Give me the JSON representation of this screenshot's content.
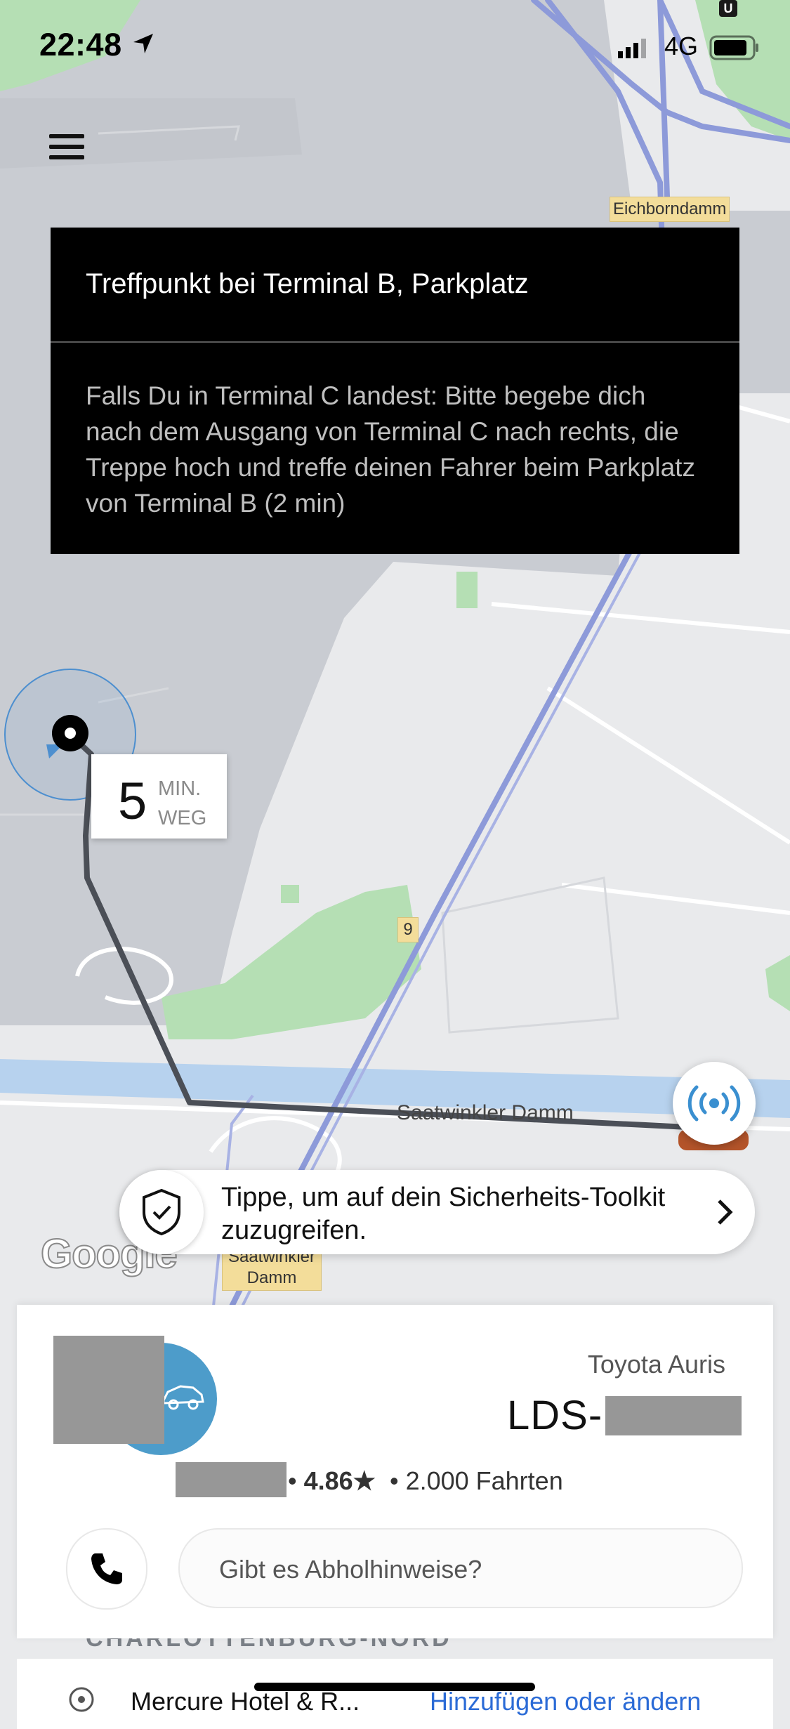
{
  "status_bar": {
    "time": "22:48",
    "network": "4G"
  },
  "map": {
    "labels": {
      "eichborndamm": "Eichborndamm",
      "route_9": "9",
      "saatwinkler_street": "Saatwinkler Damm",
      "saatwinkler_badge": "Saatwinkler\nDamm",
      "district": "CHARLOTTENBURG-NORD"
    },
    "google_logo": "Google"
  },
  "info_panel": {
    "title": "Treffpunkt bei Terminal B, Parkplatz",
    "body": "Falls Du in Terminal C landest: Bitte begebe dich nach dem Ausgang von Terminal C nach rechts, die Treppe hoch und treffe deinen Fahrer beim Parkplatz von Terminal B (2 min)"
  },
  "eta": {
    "value": "5",
    "unit_line1": "MIN.",
    "unit_line2": "WEG"
  },
  "safety": {
    "text": "Tippe, um auf dein Sicherheits-Toolkit zuzugreifen."
  },
  "driver_card": {
    "car_model": "Toyota Auris",
    "plate_prefix": "LDS-",
    "rating": "4.86★",
    "trips": "2.000 Fahrten",
    "notes_placeholder": "Gibt es Abholhinweise?"
  },
  "destination": {
    "name": "Mercure Hotel & R...",
    "action": "Hinzufügen oder ändern"
  },
  "colors": {
    "route": "#4b4f57",
    "accent_blue": "#4d9cca",
    "link": "#2b6bd6",
    "water": "#b7d2ee",
    "park": "#b5dfb4"
  },
  "icons": [
    "menu-icon",
    "location-arrow-icon",
    "signal-icon",
    "battery-icon",
    "shield-check-icon",
    "chevron-right-icon",
    "radar-icon",
    "car-icon",
    "phone-icon",
    "pin-icon"
  ]
}
